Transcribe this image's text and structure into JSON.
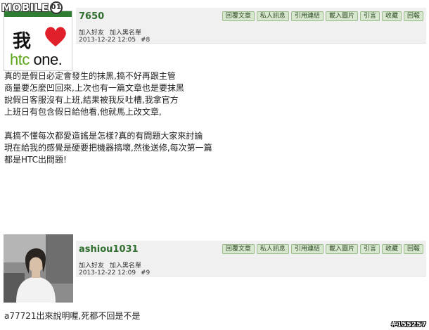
{
  "site_logo": {
    "text": "MOBILE",
    "mark": "01"
  },
  "post_buttons": [
    "回覆文章",
    "私人訊息",
    "引用連結",
    "載入圖片",
    "引言",
    "收藏",
    "回報"
  ],
  "posts": [
    {
      "username": "7650",
      "avatar": {
        "text_top": "我",
        "brand_left": "htc",
        "brand_right": " one."
      },
      "actions": [
        "加入好友",
        "加入黑名單"
      ],
      "timestamp": "2013-12-22 12:05",
      "post_number": "#8",
      "paragraphs": [
        [
          "真的是假日必定會發生的抹黑,搞不好再跟主管",
          "商量要怎麼凹回來,上次也有一篇文章也是要抹黑",
          "說假日客服沒有上班,結果被我反吐槽,我拿官方",
          "上班日有包含假日給他看,他就馬上改文章,"
        ],
        [
          "真搞不懂每次都愛造謠是怎樣?真的有問題大家來討論",
          "現在給我的感覺是硬要把機器搞壞,然後送修,每次第一篇",
          "都是HTC出問題!"
        ]
      ]
    },
    {
      "username": "ashiou1031",
      "actions": [
        "加入好友",
        "加入黑名單"
      ],
      "timestamp": "2013-12-22 12:09",
      "post_number": "#9",
      "paragraphs": [
        [
          "a77721出來說明喔,死都不回是不是"
        ]
      ]
    }
  ],
  "watermark": "#155257",
  "colors": {
    "username": "#2f6f2f",
    "button_bg": "#d8e8d0",
    "header_bg": "#f0f0f0",
    "htc_green": "#5ba618",
    "heart_red": "#e0202a"
  }
}
